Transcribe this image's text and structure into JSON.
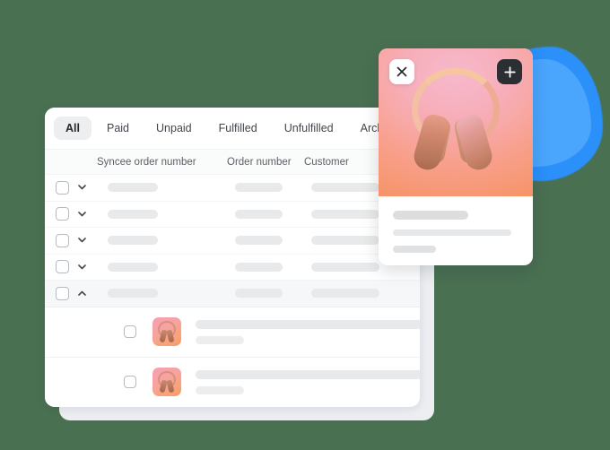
{
  "theme": {
    "background": "#4a7052",
    "panel_bg": "#ffffff",
    "back_panel_bg": "#eceef2",
    "accent_blue": "#2b90fa",
    "active_tab_bg": "#edeeef",
    "skeleton": "#e8e9ea",
    "dark_button": "#2b2f33"
  },
  "orders_panel": {
    "tabs": [
      {
        "label": "All",
        "active": true
      },
      {
        "label": "Paid",
        "active": false
      },
      {
        "label": "Unpaid",
        "active": false
      },
      {
        "label": "Fulfilled",
        "active": false
      },
      {
        "label": "Unfulfilled",
        "active": false
      },
      {
        "label": "Archived",
        "active": false
      }
    ],
    "columns": [
      {
        "label": "Syncee order number"
      },
      {
        "label": "Order number"
      },
      {
        "label": "Customer"
      }
    ],
    "rows": [
      {
        "expanded": false,
        "chevron": "chevron-down-icon"
      },
      {
        "expanded": false,
        "chevron": "chevron-down-icon"
      },
      {
        "expanded": false,
        "chevron": "chevron-down-icon"
      },
      {
        "expanded": false,
        "chevron": "chevron-down-icon"
      },
      {
        "expanded": true,
        "chevron": "chevron-up-icon"
      }
    ],
    "sub_rows": [
      {
        "thumbnail": "headphones-thumbnail"
      },
      {
        "thumbnail": "headphones-thumbnail"
      }
    ]
  },
  "product_card": {
    "image": "pink-headphones-photo",
    "close_button": {
      "icon": "close-icon",
      "label": "✕"
    },
    "add_button": {
      "icon": "plus-icon",
      "label": "+"
    }
  }
}
